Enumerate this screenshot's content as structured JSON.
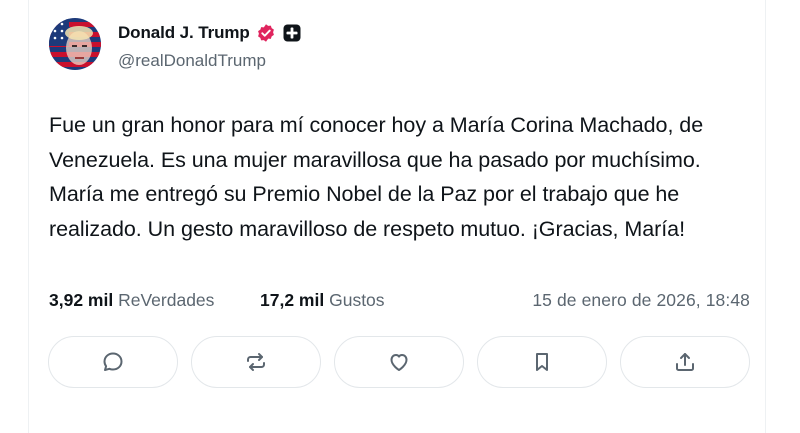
{
  "author": {
    "display_name": "Donald J. Trump",
    "handle": "@realDonaldTrump",
    "verified_icon": "verified-badge-icon",
    "extra_badge_icon": "plus-badge-icon"
  },
  "post": {
    "text": "Fue un gran honor para mí conocer hoy a María Corina Machado, de Venezuela. Es una mujer maravillosa que ha pasado por muchísimo. María me entregó su Premio Nobel de la Paz por el trabajo que he realizado. Un gesto maravilloso de respeto mutuo. ¡Gracias, María!"
  },
  "stats": {
    "reposts_count": "3,92 mil",
    "reposts_label": "ReVerdades",
    "likes_count": "17,2 mil",
    "likes_label": "Gustos",
    "timestamp": "15 de enero de 2026, 18:48"
  },
  "actions": [
    {
      "icon": "reply-icon"
    },
    {
      "icon": "repost-icon"
    },
    {
      "icon": "like-icon"
    },
    {
      "icon": "bookmark-icon"
    },
    {
      "icon": "share-icon"
    }
  ],
  "colors": {
    "text": "#0f1419",
    "muted": "#5b6670",
    "verified": "#e0245e",
    "border": "#e3e7ea"
  }
}
